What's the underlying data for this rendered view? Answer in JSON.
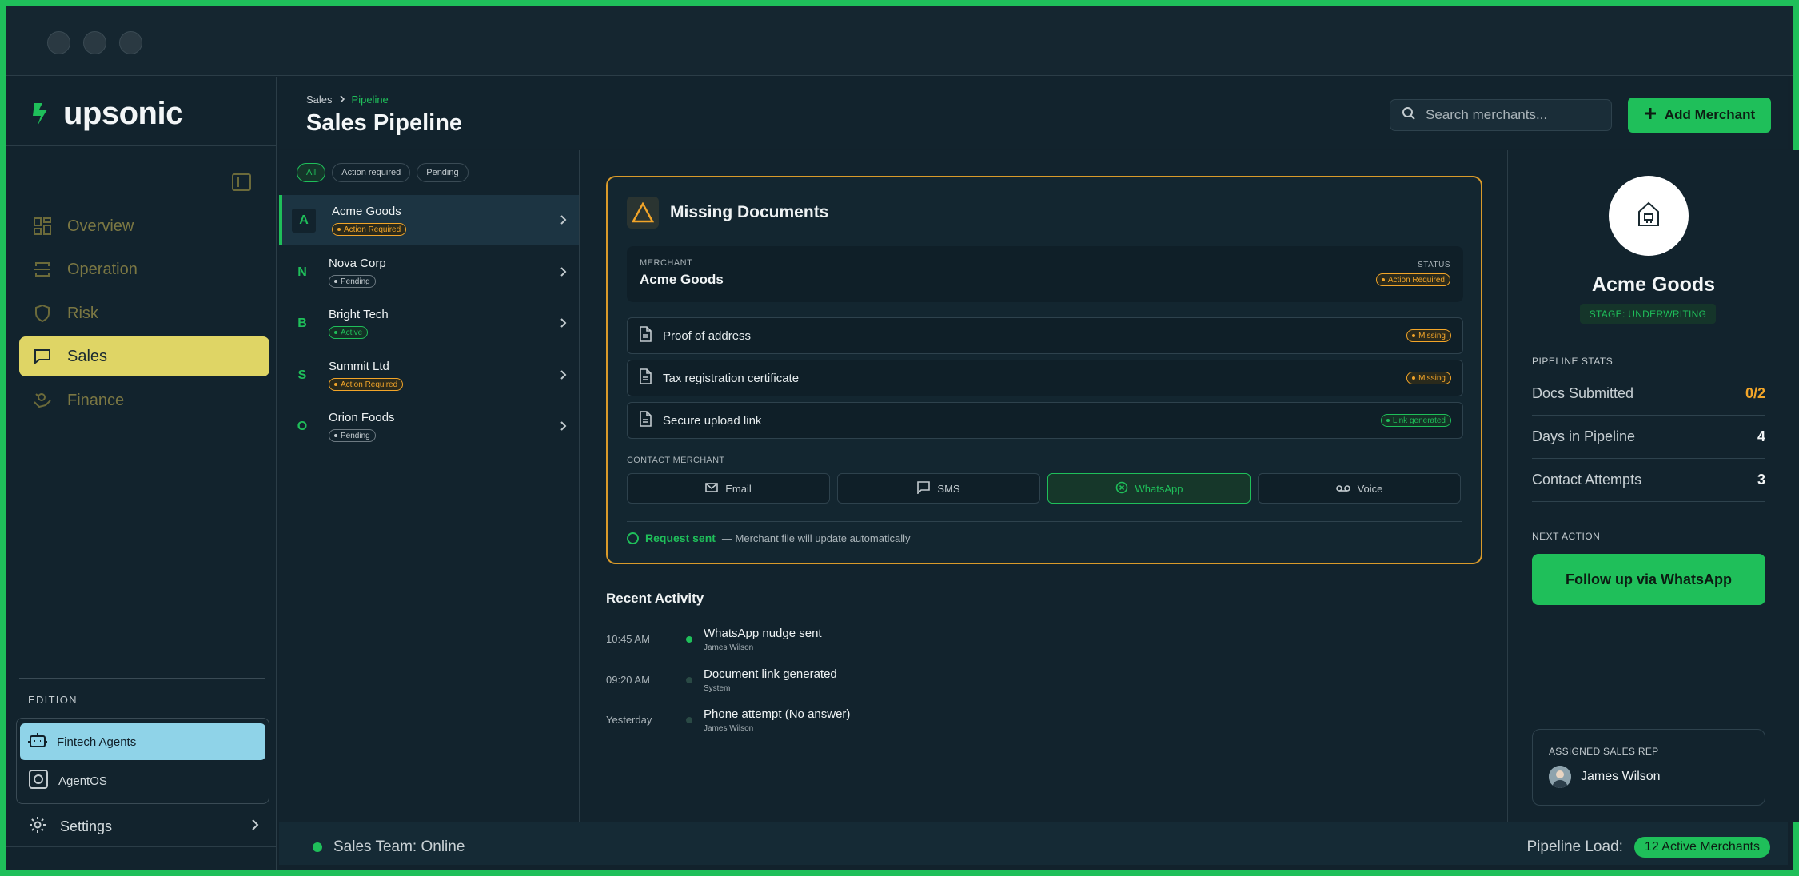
{
  "app": {
    "logo_text": "upsonic"
  },
  "sidebar": {
    "items": [
      {
        "label": "Overview",
        "icon": "grid-icon"
      },
      {
        "label": "Operation",
        "icon": "operation-icon"
      },
      {
        "label": "Risk",
        "icon": "shield-icon"
      },
      {
        "label": "Sales",
        "icon": "chat-icon"
      },
      {
        "label": "Finance",
        "icon": "finance-icon"
      }
    ],
    "edition_label": "EDITION",
    "editions": [
      {
        "label": "Fintech Agents"
      },
      {
        "label": "AgentOS"
      }
    ],
    "settings_label": "Settings"
  },
  "header": {
    "breadcrumb": [
      "Sales",
      "Pipeline"
    ],
    "title": "Sales Pipeline",
    "search_placeholder": "Search merchants...",
    "add_label": "Add Merchant"
  },
  "filters": [
    "All",
    "Action required",
    "Pending"
  ],
  "merchants": [
    {
      "initial": "A",
      "name": "Acme Goods",
      "status": "Action Required"
    },
    {
      "initial": "N",
      "name": "Nova Corp",
      "status": "Pending"
    },
    {
      "initial": "B",
      "name": "Bright Tech",
      "status": "Active"
    },
    {
      "initial": "S",
      "name": "Summit Ltd",
      "status": "Action Required"
    },
    {
      "initial": "O",
      "name": "Orion Foods",
      "status": "Pending"
    }
  ],
  "card": {
    "title": "Missing Documents",
    "merchant_label": "MERCHANT",
    "merchant_name": "Acme Goods",
    "status_label": "STATUS",
    "status": "Action Required",
    "documents": [
      {
        "name": "Proof of address",
        "status": "Missing"
      },
      {
        "name": "Tax registration certificate",
        "status": "Missing"
      },
      {
        "name": "Secure upload link",
        "status": "Link generated"
      }
    ],
    "contact_label": "CONTACT MERCHANT",
    "contact_buttons": [
      "Email",
      "SMS",
      "WhatsApp",
      "Voice"
    ],
    "request_status": "Request sent",
    "request_note": "— Merchant file will update automatically"
  },
  "activity": {
    "title": "Recent Activity",
    "items": [
      {
        "time": "10:45 AM",
        "text": "WhatsApp nudge sent",
        "by": "James Wilson"
      },
      {
        "time": "09:20 AM",
        "text": "Document link generated",
        "by": "System"
      },
      {
        "time": "Yesterday",
        "text": "Phone attempt (No answer)",
        "by": "James Wilson"
      }
    ]
  },
  "profile": {
    "name": "Acme Goods",
    "stage": "STAGE: UNDERWRITING",
    "stats_label": "PIPELINE STATS",
    "stats": [
      {
        "label": "Docs Submitted",
        "value": "0/2"
      },
      {
        "label": "Days in Pipeline",
        "value": "4"
      },
      {
        "label": "Contact Attempts",
        "value": "3"
      }
    ],
    "next_action_label": "NEXT ACTION",
    "next_action": "Follow up via WhatsApp",
    "rep_label": "ASSIGNED SALES REP",
    "rep_name": "James Wilson"
  },
  "footer": {
    "team_status": "Sales Team: Online",
    "load_label": "Pipeline Load:",
    "load_value": "12 Active Merchants"
  },
  "colors": {
    "accent": "#1fbf5a",
    "warning": "#f2a529",
    "sales_highlight": "#dfd565",
    "edition_highlight": "#8fd3e8"
  }
}
